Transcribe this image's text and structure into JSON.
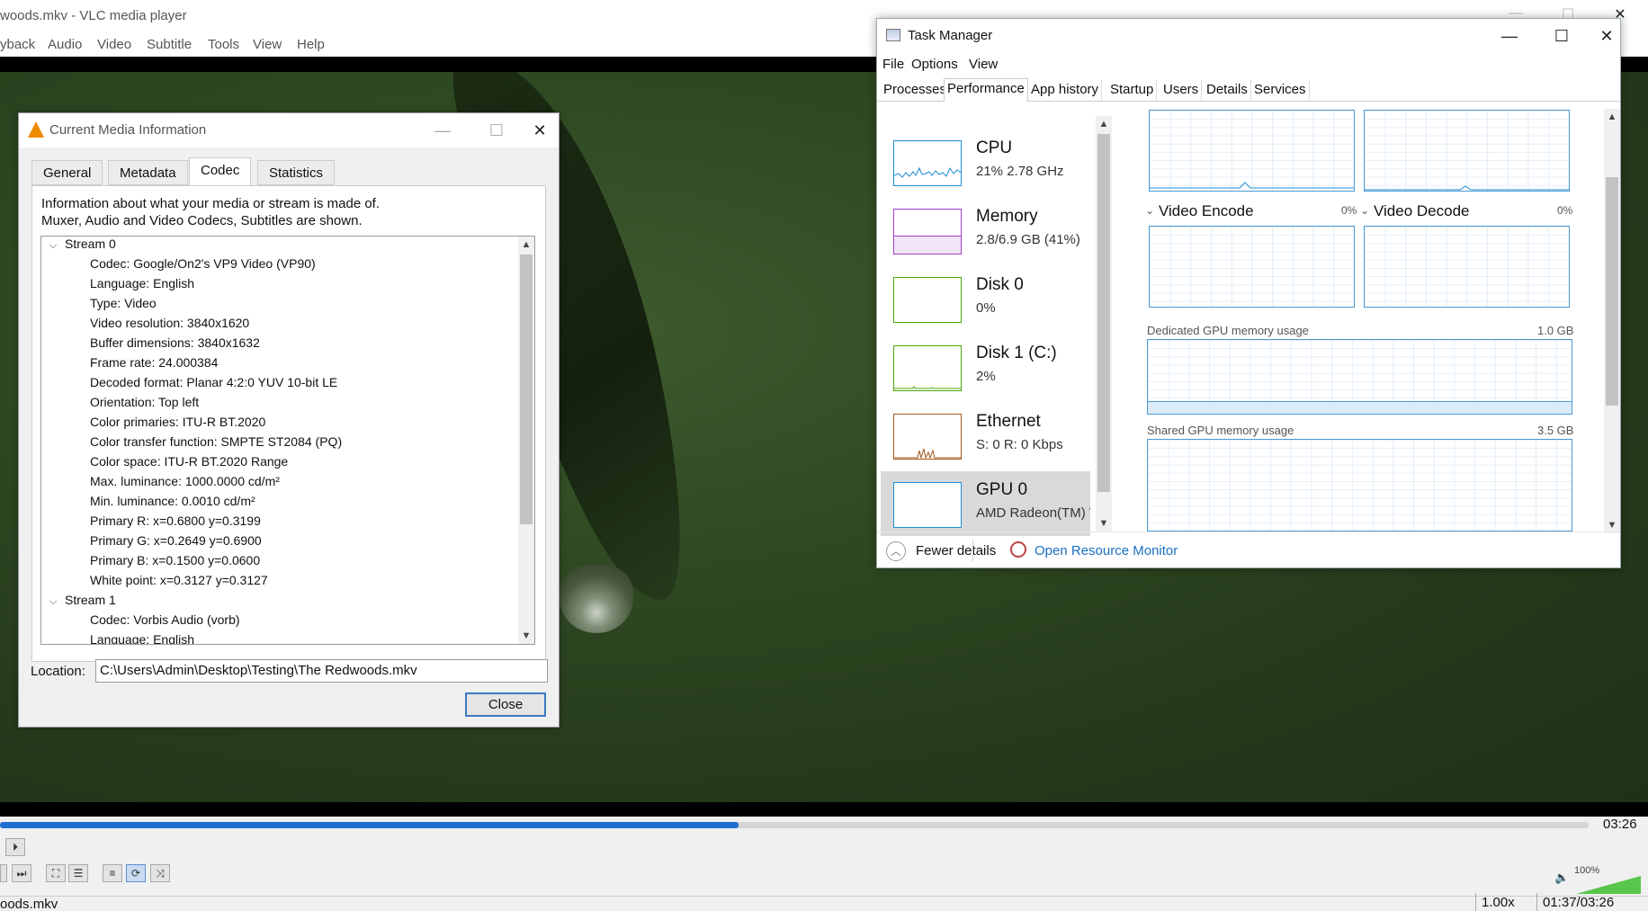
{
  "vlc": {
    "title": "woods.mkv - VLC media player",
    "menu": [
      "yback",
      "Audio",
      "Video",
      "Subtitle",
      "Tools",
      "View",
      "Help"
    ],
    "time_end": "03:26",
    "progress": 0.465,
    "volume": "100%",
    "status_file": "oods.mkv",
    "speed": "1.00x",
    "time_display": "01:37/03:26"
  },
  "media_info": {
    "title": "Current Media Information",
    "tabs": [
      "General",
      "Metadata",
      "Codec",
      "Statistics"
    ],
    "active_tab": "Codec",
    "description_line1": "Information about what your media or stream is made of.",
    "description_line2": "Muxer, Audio and Video Codecs, Subtitles are shown.",
    "streams": [
      {
        "label": "Stream 0",
        "props": [
          "Codec: Google/On2's VP9 Video (VP90)",
          "Language: English",
          "Type: Video",
          "Video resolution: 3840x1620",
          "Buffer dimensions: 3840x1632",
          "Frame rate: 24.000384",
          "Decoded format: Planar 4:2:0 YUV 10-bit LE",
          "Orientation: Top left",
          "Color primaries: ITU-R BT.2020",
          "Color transfer function: SMPTE ST2084 (PQ)",
          "Color space: ITU-R BT.2020 Range",
          "Max. luminance: 1000.0000 cd/m²",
          "Min. luminance: 0.0010 cd/m²",
          "Primary R: x=0.6800 y=0.3199",
          "Primary G: x=0.2649 y=0.6900",
          "Primary B: x=0.1500 y=0.0600",
          "White point: x=0.3127 y=0.3127"
        ]
      },
      {
        "label": "Stream 1",
        "props": [
          "Codec: Vorbis Audio (vorb)",
          "Language: English"
        ]
      }
    ],
    "location_label": "Location:",
    "location_value": "C:\\Users\\Admin\\Desktop\\Testing\\The Redwoods.mkv",
    "close_label": "Close"
  },
  "task_manager": {
    "title": "Task Manager",
    "menu": [
      "File",
      "Options",
      "View"
    ],
    "tabs": [
      "Processes",
      "Performance",
      "App history",
      "Startup",
      "Users",
      "Details",
      "Services"
    ],
    "active_tab": "Performance",
    "perf_items": [
      {
        "name": "CPU",
        "sub": "21%  2.78 GHz",
        "color": "#1f8dd6"
      },
      {
        "name": "Memory",
        "sub": "2.8/6.9 GB (41%)",
        "color": "#a43ec6"
      },
      {
        "name": "Disk 0",
        "sub": "0%",
        "color": "#4da60c"
      },
      {
        "name": "Disk 1 (C:)",
        "sub": "2%",
        "color": "#4da60c"
      },
      {
        "name": "Ethernet",
        "sub": "S: 0  R: 0 Kbps",
        "color": "#a7541a"
      },
      {
        "name": "GPU 0",
        "sub": "AMD Radeon(TM) Ve",
        "color": "#1f8dd6"
      }
    ],
    "video_encode_label": "Video Encode",
    "video_encode_pct": "0%",
    "video_decode_label": "Video Decode",
    "video_decode_pct": "0%",
    "dedicated_label": "Dedicated GPU memory usage",
    "dedicated_max": "1.0 GB",
    "shared_label": "Shared GPU memory usage",
    "shared_max": "3.5 GB",
    "fewer_details": "Fewer details",
    "open_resource_monitor": "Open Resource Monitor"
  }
}
